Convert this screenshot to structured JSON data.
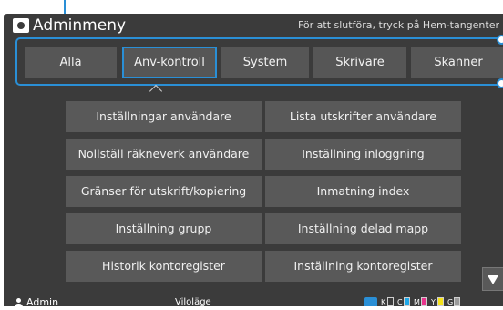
{
  "header": {
    "title": "Adminmeny",
    "hint": "För att slutföra, tryck på Hem-tangenter"
  },
  "tabs": [
    {
      "label": "Alla",
      "active": false
    },
    {
      "label": "Anv-kontroll",
      "active": true
    },
    {
      "label": "System",
      "active": false
    },
    {
      "label": "Skrivare",
      "active": false
    },
    {
      "label": "Skanner",
      "active": false
    }
  ],
  "menu": {
    "left": [
      "Inställningar användare",
      "Nollställ räkneverk användare",
      "Gränser för utskrift/kopiering",
      "Inställning grupp",
      "Historik kontoregister"
    ],
    "right": [
      "Lista utskrifter användare",
      "Inställning inloggning",
      "Inmatning index",
      "Inställning delad mapp",
      "Inställning kontoregister"
    ]
  },
  "status": {
    "user": "Admin",
    "mode": "Viloläge",
    "inks": [
      {
        "label": "K",
        "color": "#333333"
      },
      {
        "label": "C",
        "color": "#1ea7e8"
      },
      {
        "label": "M",
        "color": "#e8338c"
      },
      {
        "label": "Y",
        "color": "#f5e21a"
      },
      {
        "label": "G",
        "color": "#9a9a9a"
      }
    ]
  },
  "colors": {
    "accent": "#2a8fd6",
    "panel": "#3b3b3b",
    "button": "#595959"
  }
}
